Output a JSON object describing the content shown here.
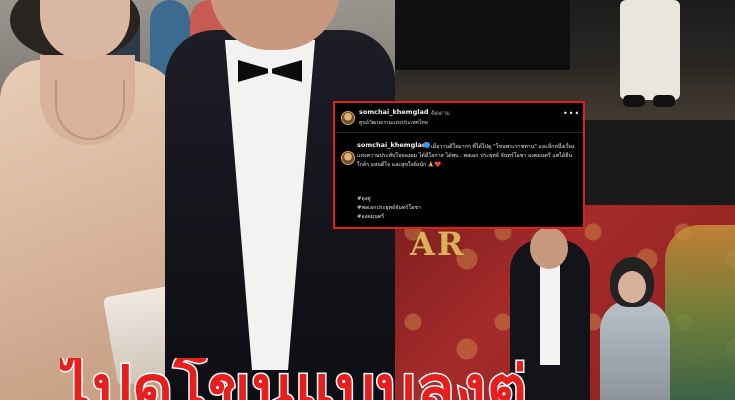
{
  "instagram_post": {
    "username": "somchai_khemglad",
    "follow_label": "ติดตาม",
    "location": "ศูนย์วัฒนธรรมแห่งประเทศไทย",
    "more_icon": "ellipsis-icon",
    "verified_icon": "verified-badge-icon",
    "caption_username": "somchai_khemglad",
    "caption_text": "เมื่อวานดีใจมากๆ ที่ได้ไปดู \"โขนพระราชทาน\" และอีกหนึ่งเรื่องแห่งความประทับใจของผม ได้มีโอกาส ได้พบ.. พลเอก ประยุทธ์ จันทร์โอชา องคมนตรี แต่ได้ยืนใกล้ๆ แสนดีใจ และสุขใจยิ่งนัก 🙏❤️",
    "hashtags": [
      "#ลุงตู่",
      "#พลเอกประยุทธ์จันทร์โอชา",
      "#องคมนตรี"
    ]
  },
  "headline": {
    "text": "ไปดูโขนแบบลุงตู่",
    "color": "#e61e1e",
    "stroke_color": "#ffffff"
  },
  "background_text": {
    "gold_sign": "AR"
  },
  "colors": {
    "overlay_border": "#e0201a",
    "overlay_bg": "#000000",
    "verified": "#3897f0"
  }
}
